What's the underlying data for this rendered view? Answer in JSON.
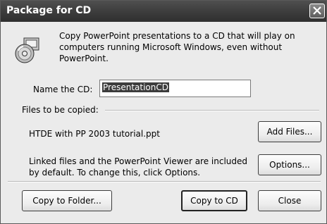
{
  "window": {
    "title": "Package for CD"
  },
  "description": "Copy PowerPoint presentations to a CD that will play on computers running Microsoft Windows, even without PowerPoint.",
  "name_cd": {
    "label": "Name the CD:",
    "value": "PresentationCD"
  },
  "files": {
    "group_label": "Files to be copied:",
    "file_name": "HTDE with PP 2003 tutorial.ppt",
    "add_button": "Add Files...",
    "linked_note": "Linked files and the PowerPoint Viewer are included by default. To change this, click Options.",
    "options_button": "Options..."
  },
  "footer": {
    "copy_folder_button": "Copy to Folder...",
    "copy_cd_button": "Copy to CD",
    "close_button": "Close"
  },
  "icons": {
    "title_close": "close-icon",
    "cd": "cd-package-icon"
  }
}
